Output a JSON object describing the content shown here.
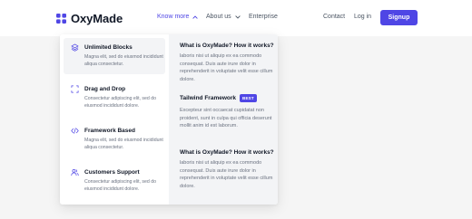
{
  "brand": {
    "name": "OxyMade"
  },
  "nav": {
    "links": [
      {
        "label": "Know more",
        "active": true
      },
      {
        "label": "About us"
      },
      {
        "label": "Enterprise"
      }
    ],
    "contact_label": "Contact",
    "login_label": "Log in",
    "signup_label": "Signup"
  },
  "dropdown": {
    "items": [
      {
        "title": "Unlimited Blocks",
        "desc": "Magna elit, sed do eiusmod incididunt aliqua consectetur.",
        "icon": "layers-icon"
      },
      {
        "title": "Drag and Drop",
        "desc": "Consectetur adipiscing elit, sed do eiusmod incididunt dolore.",
        "icon": "drag-frame-icon"
      },
      {
        "title": "Framework Based",
        "desc": "Magna elit, sed do eiusmod incididunt aliqua consectetur.",
        "icon": "code-icon"
      },
      {
        "title": "Customers Support",
        "desc": "Consectetur adipiscing elit, sed do eiusmod incididunt dolore.",
        "icon": "users-icon"
      }
    ],
    "right": {
      "block1": {
        "title": "What is OxyMade? How it works?",
        "text": "laboris nisi ut aliquip ex ea commodo consequat. Duis aute irure dolor in reprehenderit in voluptate velit esse cillum dolore."
      },
      "block2": {
        "title": "Tailwind Framework",
        "badge": "BEST",
        "text": "Excepteur sint occaecat cupidatat non proident, sunt in culpa qui officia deserunt mollit anim id est laborum."
      },
      "block3": {
        "title": "What is OxyMade? How it works?",
        "text": "laboris nisi ut aliquip ex ea commodo consequat. Duis aute irure dolor in reprehenderit in voluptate velit esse cillum dolore."
      }
    }
  },
  "colors": {
    "accent": "#4f46e5",
    "text": "#111827",
    "muted": "#6b7280",
    "panel": "#f3f4f6",
    "band": "#f5f5f5"
  }
}
